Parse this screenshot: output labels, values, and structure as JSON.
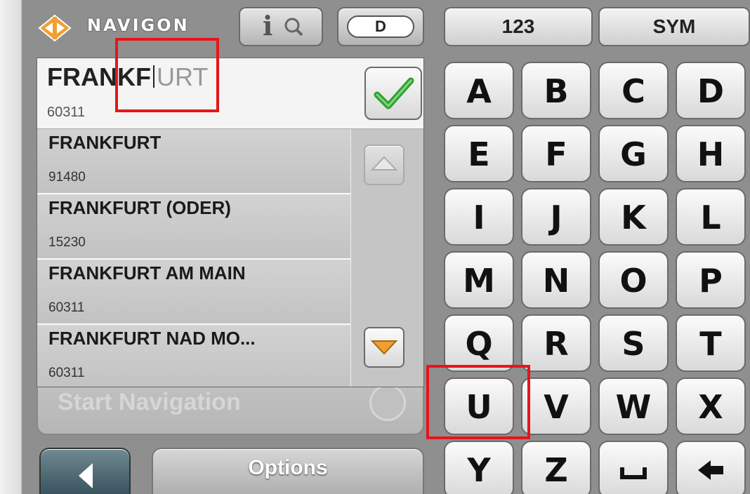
{
  "header": {
    "brand": "NAVIGON",
    "info_button_text": "i",
    "country_code": "D",
    "mode_buttons": [
      "123",
      "SYM"
    ]
  },
  "search": {
    "typed_text": "FRANKF",
    "suggestion_remainder": "URT",
    "postal_code": "60311"
  },
  "results": [
    {
      "name": "FRANKFURT",
      "zip": "91480"
    },
    {
      "name": "FRANKFURT (ODER)",
      "zip": "15230"
    },
    {
      "name": "FRANKFURT AM MAIN",
      "zip": "60311"
    },
    {
      "name": "FRANKFURT NAD MO...",
      "zip": "60311"
    }
  ],
  "start_navigation_label": "Start Navigation",
  "options_label": "Options",
  "keyboard": {
    "rows": [
      [
        "A",
        "B",
        "C",
        "D"
      ],
      [
        "E",
        "F",
        "G",
        "H"
      ],
      [
        "I",
        "J",
        "K",
        "L"
      ],
      [
        "M",
        "N",
        "O",
        "P"
      ],
      [
        "Q",
        "R",
        "S",
        "T"
      ],
      [
        "U",
        "V",
        "W",
        "X"
      ],
      [
        "Y",
        "Z",
        "space-icon",
        "backspace-icon"
      ]
    ]
  },
  "colors": {
    "highlight": "#e5161a",
    "logo_orange": "#f0a030",
    "checkmark_green": "#2fa12f"
  }
}
